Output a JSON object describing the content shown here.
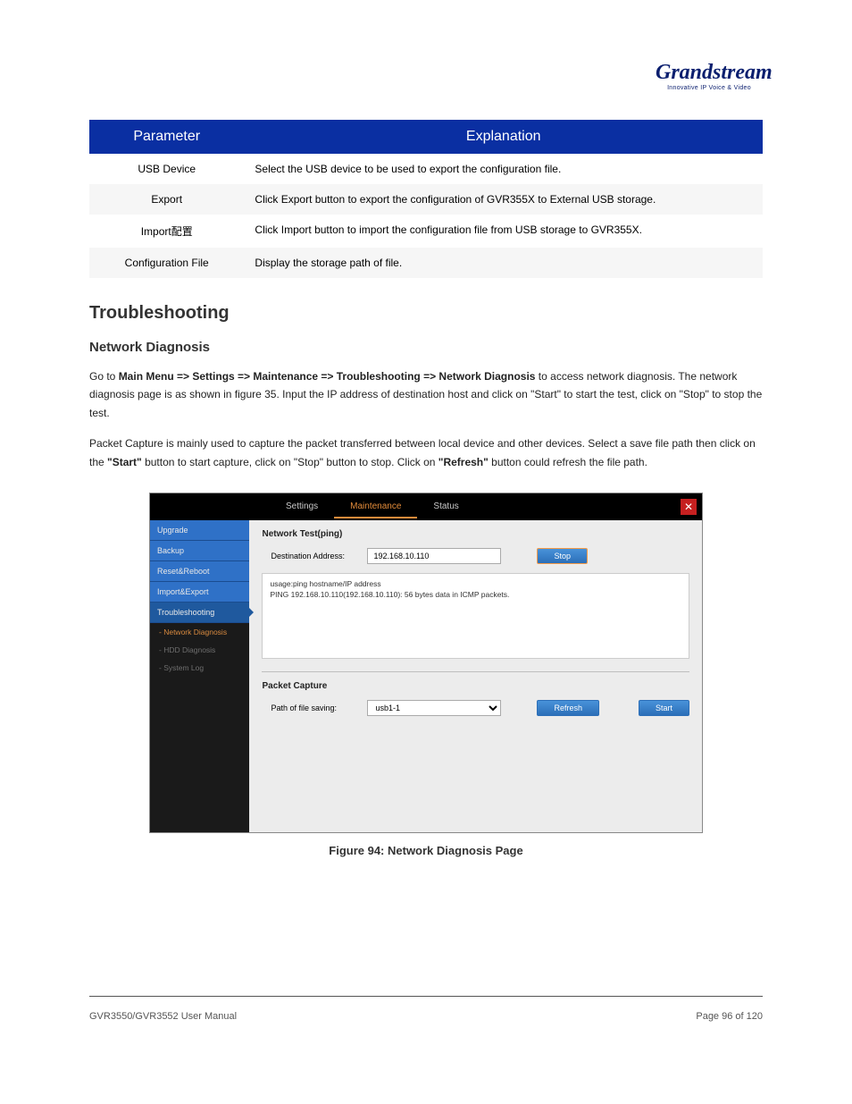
{
  "logo": {
    "brand": "Grandstream",
    "tagline": "Innovative IP Voice & Video"
  },
  "table": {
    "headers": {
      "param": "Parameter",
      "exp": "Explanation"
    },
    "rows": [
      {
        "p": "USB Device",
        "e": "Select the USB device to be used to export the configuration file."
      },
      {
        "p": "Export",
        "e": "Click Export button to export the configuration of GVR355X to External USB storage."
      },
      {
        "p": "Import配置",
        "e": "Click Import button to import the configuration file from USB storage to GVR355X."
      },
      {
        "p": "Configuration File",
        "e": "Display the storage path of file."
      }
    ]
  },
  "section": {
    "title": "Troubleshooting",
    "sub": "Network Diagnosis"
  },
  "para1_a": "Go to ",
  "para1_b": "Main Menu => Settings => Maintenance => Troubleshooting => Network Diagnosis",
  "para1_c": " to access network diagnosis. The network diagnosis page is as shown in figure 35. Input the IP address of destination host and click on \"Start\" to start the test, click on \"Stop\" to stop the test.",
  "para2_a": "Packet Capture is mainly used to capture the packet transferred between local device and other devices. Select a save file path then click on the ",
  "para2_b": "\"Start\"",
  "para2_c": " button to start capture, click on \"Stop\" button to stop. Click on ",
  "para2_d": "\"Refresh\"",
  "para2_e": " button could refresh the file path.",
  "ui": {
    "tabs": {
      "settings": "Settings",
      "maintenance": "Maintenance",
      "status": "Status"
    },
    "sidebar": {
      "items": [
        "Upgrade",
        "Backup",
        "Reset&Reboot",
        "Import&Export",
        "Troubleshooting"
      ],
      "subs": [
        "Network Diagnosis",
        "HDD Diagnosis",
        "System Log"
      ]
    },
    "net_test": {
      "title": "Network Test(ping)",
      "dest_label": "Destination Address:",
      "dest_value": "192.168.10.110",
      "stop": "Stop",
      "output": "usage:ping hostname/IP address\nPING 192.168.10.110(192.168.10.110): 56 bytes data in ICMP packets."
    },
    "packet": {
      "title": "Packet Capture",
      "path_label": "Path of file saving:",
      "path_value": "usb1-1",
      "refresh": "Refresh",
      "start": "Start"
    }
  },
  "figure": "Figure 94: Network Diagnosis Page",
  "footer": {
    "left": "GVR3550/GVR3552 User Manual",
    "right_label": "Page ",
    "right_page": "96",
    "right_total": " of 120"
  }
}
